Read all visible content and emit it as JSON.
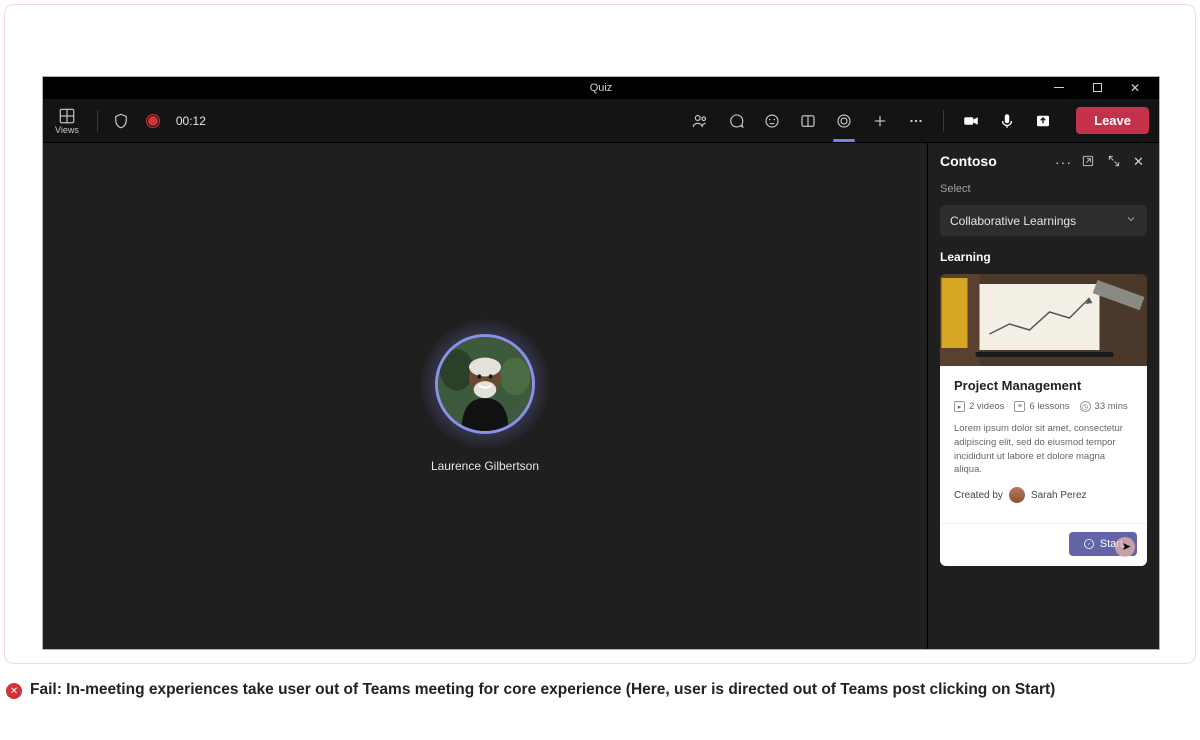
{
  "window": {
    "title": "Quiz"
  },
  "toolbar": {
    "views_label": "Views",
    "timer": "00:12",
    "leave_label": "Leave"
  },
  "participant": {
    "name": "Laurence Gilbertson"
  },
  "panel": {
    "title": "Contoso",
    "select_label": "Select",
    "select_value": "Collaborative Learnings",
    "section_title": "Learning",
    "card": {
      "title": "Project Management",
      "videos": "2 videos",
      "lessons": "6 lessons",
      "duration": "33 mins",
      "description": "Lorem ipsum dolor sit amet, consectetur adipiscing elit, sed do eiusmod tempor incididunt ut labore et dolore magna aliqua.",
      "created_by_label": "Created by",
      "creator": "Sarah Perez",
      "start_label": "Start"
    }
  },
  "caption": {
    "text": "Fail: In-meeting experiences take user out of Teams meeting for core experience (Here, user is directed out of Teams post clicking on Start)"
  }
}
